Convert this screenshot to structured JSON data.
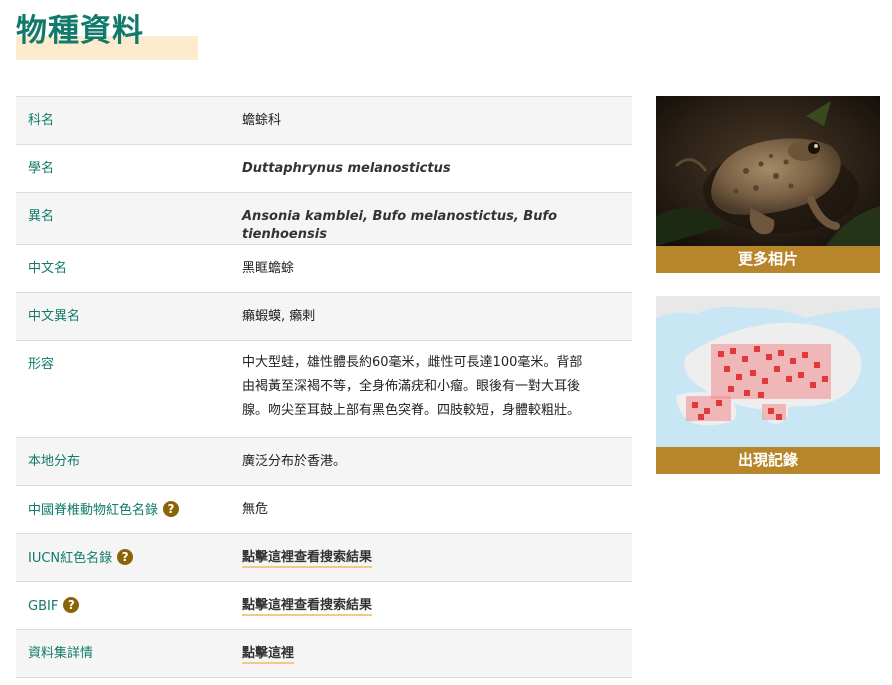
{
  "page": {
    "title": "物種資料"
  },
  "rows": [
    {
      "label": "科名",
      "value": "蟾蜍科"
    },
    {
      "label": "學名",
      "value": "Duttaphrynus melanostictus"
    },
    {
      "label": "異名",
      "value": "Ansonia kamblei, Bufo melanostictus, Bufo tienhoensis"
    },
    {
      "label": "中文名",
      "value": "黑眶蟾蜍"
    },
    {
      "label": "中文異名",
      "value": "癩蝦蟆, 癩剌"
    },
    {
      "label": "形容",
      "value_lines": [
        "中大型蛙，雄性體長約60毫米，雌性可長達100毫米。背部",
        "由褐黃至深褐不等，全身佈滿疣和小瘤。眼後有一對大耳後",
        "腺。吻尖至耳鼓上部有黑色突脊。四肢較短，身體較粗壯。"
      ]
    },
    {
      "label": "本地分布",
      "value": "廣泛分布於香港。"
    },
    {
      "label": "中國脊椎動物紅色名錄",
      "value": "無危"
    },
    {
      "label": "IUCN紅色名錄",
      "value": "點擊這裡查看搜索結果"
    },
    {
      "label": "GBIF",
      "value": "點擊這裡查看搜索結果"
    },
    {
      "label": "資料集詳情",
      "value": "點擊這裡"
    }
  ],
  "help_symbol": "?",
  "side": {
    "photo_caption": "更多相片",
    "map_caption": "出現記錄"
  },
  "colors": {
    "accent": "#117a6b",
    "caption_bg": "#b8862a",
    "help_bg": "#8a6508",
    "title_highlight": "#fdebd0"
  }
}
